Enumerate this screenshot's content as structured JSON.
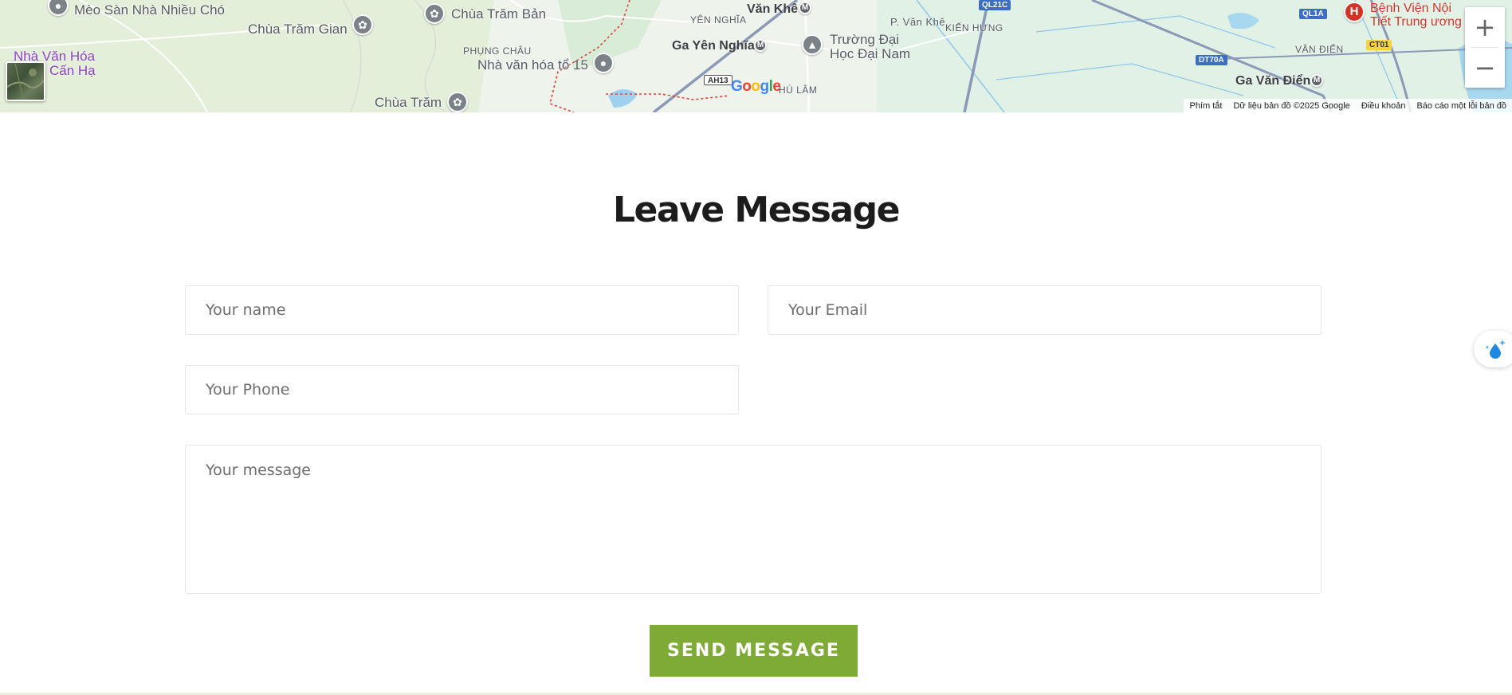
{
  "map": {
    "places": {
      "meo_san": "Mèo Sàn Nhà Nhiều Chó",
      "chua_tram_gian": "Chùa Trăm Gian",
      "chua_tram_ban": "Chùa Trăm Bản",
      "phung_chau": "PHỤNG CHÂU",
      "nha_van_hoa_to15": "Nhà văn hóa tổ 15",
      "chua_tram": "Chùa Trăm",
      "nha_van_hoa_can_ha_1": "Nhà Văn Hóa",
      "nha_van_hoa_can_ha_2": "Cấn Hạ",
      "yen_nghia": "YÊN NGHĨA",
      "van_khe": "Văn Khê",
      "ga_yen_nghia": "Ga Yên Nghĩa",
      "truong_dai_1": "Trường Đại",
      "truong_dai_2": "Học Đại Nam",
      "p_van_khe": "P. Văn Khê",
      "kien_hung": "KIẾN HƯNG",
      "hu_lam": "HÚ LÂM",
      "van_dien": "VĂN ĐIỂN",
      "ga_van_dien": "Ga Văn Điển",
      "benh_vien_1": "Bệnh Viện Nội",
      "benh_vien_2": "Tiết Trung ương"
    },
    "shields": {
      "ql21c": "QL21C",
      "ql1a": "QL1A",
      "ct01": "CT01",
      "dt70a": "DT70A",
      "ah13": "AH13"
    },
    "attribution": {
      "shortcuts": "Phím tắt",
      "data": "Dữ liệu bản đồ ©2025 Google",
      "terms": "Điều khoản",
      "report": "Báo cáo một lỗi bản đồ"
    },
    "google_logo": "Google",
    "zoom_in": "+",
    "zoom_out": "−"
  },
  "form": {
    "title": "Leave Message",
    "name_placeholder": "Your name",
    "email_placeholder": "Your Email",
    "phone_placeholder": "Your Phone",
    "message_placeholder": "Your message",
    "submit_label": "SEND MESSAGE"
  },
  "colors": {
    "accent": "#7eaa36",
    "title": "#1c1c1c",
    "map_land": "#e7f3e4"
  },
  "icons": [
    "place-pin-icon",
    "pagoda-icon",
    "metro-icon",
    "school-icon",
    "hospital-icon",
    "satellite-layer-icon",
    "magic-drop-icon"
  ]
}
